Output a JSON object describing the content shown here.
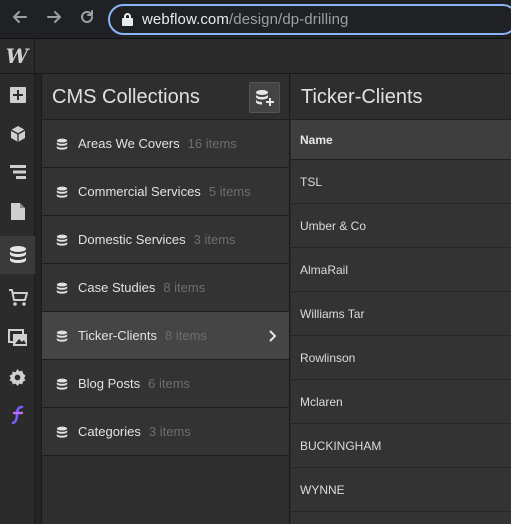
{
  "browser": {
    "url_domain": "webflow.com",
    "url_path": "/design/dp-drilling",
    "back_icon": "arrow-left-icon",
    "forward_icon": "arrow-right-icon",
    "reload_icon": "reload-icon"
  },
  "app": {
    "logo": "W"
  },
  "rail": {
    "items": [
      {
        "icon": "add-icon"
      },
      {
        "icon": "cube-icon"
      },
      {
        "icon": "navigator-icon"
      },
      {
        "icon": "page-icon"
      },
      {
        "icon": "database-icon",
        "active": true
      },
      {
        "icon": "cart-icon"
      },
      {
        "icon": "assets-icon"
      },
      {
        "icon": "gear-icon"
      },
      {
        "icon": "logic-icon"
      }
    ]
  },
  "cms": {
    "title": "CMS Collections",
    "collections": [
      {
        "name": "Areas We Covers",
        "count": "16 items"
      },
      {
        "name": "Commercial Services",
        "count": "5 items"
      },
      {
        "name": "Domestic Services",
        "count": "3 items"
      },
      {
        "name": "Case Studies",
        "count": "8 items"
      },
      {
        "name": "Ticker-Clients",
        "count": "8 items",
        "active": true
      },
      {
        "name": "Blog Posts",
        "count": "6 items"
      },
      {
        "name": "Categories",
        "count": "3 items"
      }
    ]
  },
  "items": {
    "title": "Ticker-Clients",
    "column_header": "Name",
    "rows": [
      "TSL",
      "Umber & Co",
      "AlmaRail",
      "Williams Tar",
      "Rowlinson",
      "Mclaren",
      "BUCKINGHAM",
      "WYNNE"
    ]
  },
  "colors": {
    "accent_focus": "#8ab4f8",
    "logic_icon": "#7c5cff"
  }
}
